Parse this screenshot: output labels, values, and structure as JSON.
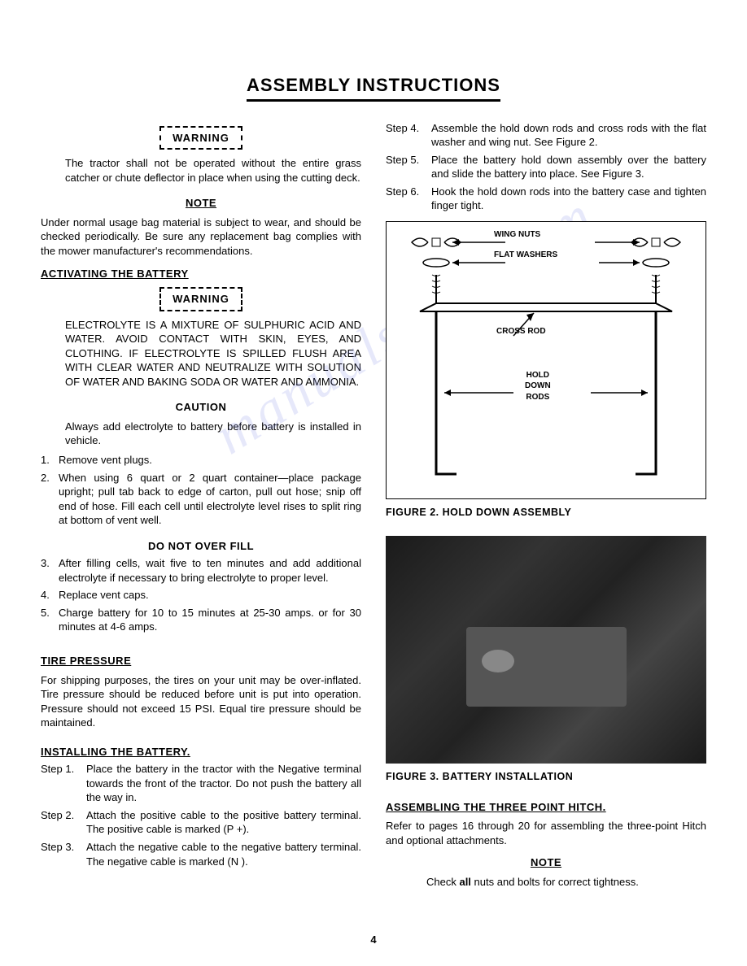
{
  "title": "ASSEMBLY INSTRUCTIONS",
  "warning_label": "WARNING",
  "note_label": "NOTE",
  "caution_label": "CAUTION",
  "left": {
    "warn1": "The tractor shall not be operated without the entire grass catcher or chute deflector in place when using the cutting deck.",
    "note1": "Under normal usage bag material is subject to wear, and should be checked periodically. Be sure any replacement bag complies with the mower manufacturer's recommendations.",
    "activating_heading": "ACTIVATING THE BATTERY",
    "warn2": "ELECTROLYTE IS A MIXTURE OF SULPHURIC ACID AND WATER. AVOID CONTACT WITH SKIN, EYES, AND CLOTHING. IF ELECTROLYTE IS SPILLED FLUSH AREA WITH CLEAR WATER AND NEUTRALIZE WITH SOLUTION OF WATER AND BAKING SODA OR WATER AND AMMONIA.",
    "caution1": "Always add electrolyte to battery before battery is installed in vehicle.",
    "battery_steps": [
      {
        "n": "1.",
        "t": "Remove vent plugs."
      },
      {
        "n": "2.",
        "t": "When using 6 quart or 2 quart container—place package upright; pull tab back to edge of carton, pull out hose; snip off end of hose. Fill each cell until electrolyte level rises to split ring at bottom of vent well."
      }
    ],
    "no_overfill": "DO NOT OVER FILL",
    "battery_steps2": [
      {
        "n": "3.",
        "t": "After filling cells, wait five to ten minutes and add additional electrolyte if necessary to bring electrolyte to proper level."
      },
      {
        "n": "4.",
        "t": "Replace vent caps."
      },
      {
        "n": "5.",
        "t": "Charge battery for 10 to 15 minutes at 25-30 amps. or for 30 minutes at 4-6 amps."
      }
    ],
    "tire_heading": "TIRE PRESSURE",
    "tire_text": "For shipping purposes, the tires on your unit may be over-inflated. Tire pressure should be reduced before unit is put into operation. Pressure should not exceed 15 PSI. Equal tire pressure should be maintained.",
    "install_heading": "INSTALLING THE BATTERY.",
    "install_steps": [
      {
        "n": "Step 1.",
        "t": "Place the battery in the tractor with the Negative terminal towards the front of the tractor. Do not push the battery all the way in."
      },
      {
        "n": "Step 2.",
        "t": "Attach the positive cable to the positive battery terminal. The positive cable is marked (P +)."
      },
      {
        "n": "Step 3.",
        "t": "Attach the negative cable to the negative battery terminal. The negative cable is marked (N )."
      }
    ]
  },
  "right": {
    "install_steps2": [
      {
        "n": "Step 4.",
        "t": "Assemble the hold down rods and cross rods with the flat washer and wing nut. See Figure 2."
      },
      {
        "n": "Step 5.",
        "t": "Place the battery hold down assembly over the battery and slide the battery into place. See Figure 3."
      },
      {
        "n": "Step 6.",
        "t": "Hook the hold down rods into the battery case and tighten finger tight."
      }
    ],
    "fig2_labels": {
      "wing": "WING NUTS",
      "washers": "FLAT WASHERS",
      "cross": "CROSS ROD",
      "hold1": "HOLD",
      "hold2": "DOWN",
      "hold3": "RODS"
    },
    "fig2_caption": "FIGURE 2. HOLD DOWN ASSEMBLY",
    "fig3_caption": "FIGURE 3. BATTERY INSTALLATION",
    "assembling_heading": "ASSEMBLING THE THREE POINT HITCH.",
    "assembling_text": "Refer to pages 16 through 20 for assembling the three-point Hitch and optional attachments.",
    "note2_pre": "Check ",
    "note2_bold": "all",
    "note2_post": " nuts and bolts for correct tightness."
  },
  "page_number": "4",
  "watermark": "manualshive.com"
}
